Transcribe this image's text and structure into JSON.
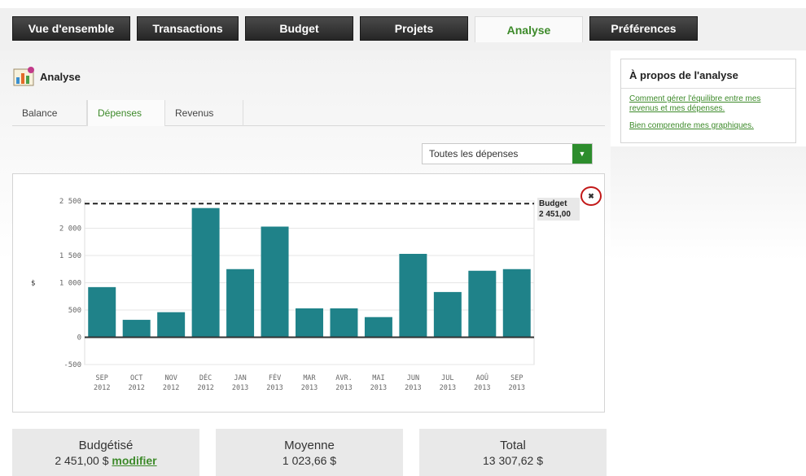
{
  "nav": {
    "tabs": [
      {
        "label": "Vue d'ensemble"
      },
      {
        "label": "Transactions"
      },
      {
        "label": "Budget"
      },
      {
        "label": "Projets"
      },
      {
        "label": "Analyse"
      },
      {
        "label": "Préférences"
      }
    ],
    "active": "Analyse"
  },
  "section": {
    "title": "Analyse",
    "icon": "chart-analysis-icon"
  },
  "subtabs": [
    {
      "label": "Balance"
    },
    {
      "label": "Dépenses"
    },
    {
      "label": "Revenus"
    }
  ],
  "filter": {
    "value": "Toutes les dépenses",
    "icon": "dropdown-arrow-icon"
  },
  "chart_data": {
    "type": "bar",
    "ylabel": "$",
    "ylim": [
      -500,
      2500
    ],
    "yticks": [
      "2 500",
      "2 000",
      "1 500",
      "1 000",
      "500",
      "0",
      "-500"
    ],
    "categories": [
      [
        "SEP",
        "2012"
      ],
      [
        "OCT",
        "2012"
      ],
      [
        "NOV",
        "2012"
      ],
      [
        "DÉC",
        "2012"
      ],
      [
        "JAN",
        "2013"
      ],
      [
        "FÉV",
        "2013"
      ],
      [
        "MAR",
        "2013"
      ],
      [
        "AVR.",
        "2013"
      ],
      [
        "MAI",
        "2013"
      ],
      [
        "JUN",
        "2013"
      ],
      [
        "JUL",
        "2013"
      ],
      [
        "AOÛ",
        "2013"
      ],
      [
        "SEP",
        "2013"
      ]
    ],
    "values": [
      920,
      320,
      460,
      2370,
      1250,
      2030,
      530,
      530,
      370,
      1530,
      830,
      1220,
      1250
    ],
    "budget_line": 2451,
    "budget_label": "Budget",
    "budget_value": "2 451,00",
    "bar_color": "#1f8289",
    "grid": true
  },
  "close_icon": "close-icon",
  "summary": {
    "budgeted_label": "Budgétisé",
    "budgeted_value": "2 451,00 $",
    "modify_link": "modifier",
    "average_label": "Moyenne",
    "average_value": "1 023,66 $",
    "total_label": "Total",
    "total_value": "13 307,62 $"
  },
  "about": {
    "title": "À propos de l'analyse",
    "link1": "Comment gérer l'équilibre entre mes revenus et mes dépenses.",
    "link2": "Bien comprendre mes graphiques."
  }
}
